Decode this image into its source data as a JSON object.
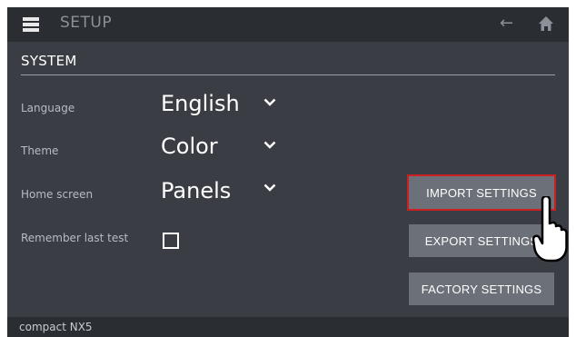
{
  "header": {
    "menu_icon": "menu-icon",
    "title": "SETUP",
    "back_icon": "back-arrow-icon",
    "back_glyph": "←",
    "home_icon": "home-icon"
  },
  "section": {
    "title": "SYSTEM"
  },
  "settings": {
    "language": {
      "label": "Language",
      "value": "English",
      "icon": "chevron-down-icon"
    },
    "theme": {
      "label": "Theme",
      "value": "Color",
      "icon": "chevron-down-icon"
    },
    "home_screen": {
      "label": "Home screen",
      "value": "Panels",
      "icon": "chevron-down-icon"
    },
    "remember_last_test": {
      "label": "Remember last test",
      "checked": false
    }
  },
  "buttons": {
    "import": "IMPORT SETTINGS",
    "export": "EXPORT SETTINGS",
    "factory": "FACTORY SETTINGS"
  },
  "footer": {
    "device_name": "compact NX5"
  },
  "cursor": {
    "icon": "pointing-hand-cursor-icon"
  },
  "colors": {
    "background": "#3a3d43",
    "bar": "#2a2d32",
    "button": "#6b7079",
    "highlight": "#cc2020"
  }
}
